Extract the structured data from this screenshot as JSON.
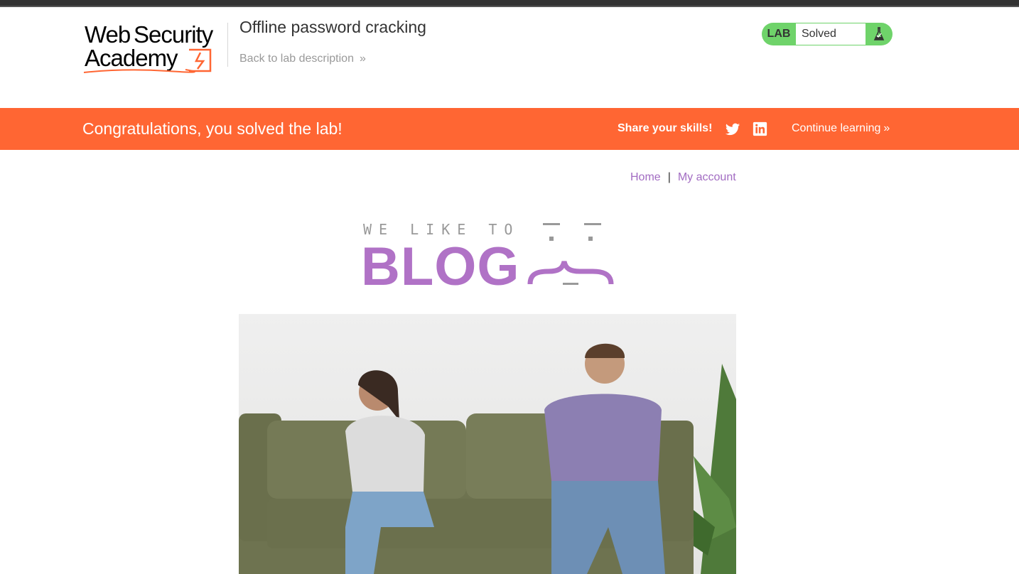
{
  "header": {
    "logo_alt": "Web Security Academy",
    "lab_title": "Offline password cracking",
    "back_link": "Back to lab description",
    "back_link_chevron": "»",
    "lab_badge": "LAB",
    "lab_status": "Solved"
  },
  "banner": {
    "congrats": "Congratulations, you solved the lab!",
    "share_label": "Share your skills!",
    "continue_label": "Continue learning",
    "continue_chevron": "»"
  },
  "nav": {
    "home": "Home",
    "separator": "|",
    "my_account": "My account"
  },
  "blog_logo": {
    "small_text": "WE LIKE TO",
    "big_text": "BLOG"
  },
  "colors": {
    "banner": "#ff6633",
    "lab_green": "#6fd36a",
    "link_purple": "#a26cc2",
    "blog_purple": "#b072c6"
  },
  "icons": [
    "twitter-icon",
    "linkedin-icon",
    "flask-icon",
    "chevron-double-right-icon"
  ]
}
